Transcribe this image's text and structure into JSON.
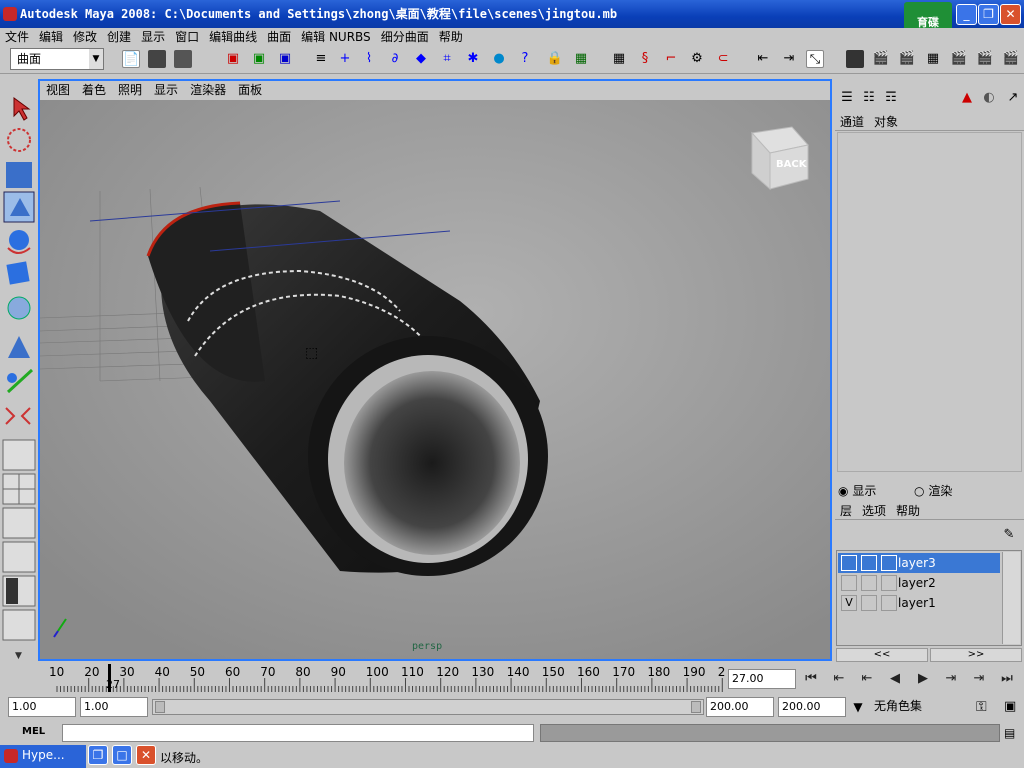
{
  "window": {
    "title": "Autodesk Maya 2008: C:\\Documents and Settings\\zhong\\桌面\\教程\\file\\scenes\\jingtou.mb",
    "logo_text": "育碟\n软件"
  },
  "menu": [
    "文件",
    "编辑",
    "修改",
    "创建",
    "显示",
    "窗口",
    "编辑曲线",
    "曲面",
    "编辑 NURBS",
    "细分曲面",
    "帮助"
  ],
  "shelf": {
    "menu_set": "曲面"
  },
  "viewport": {
    "menu": [
      "视图",
      "着色",
      "照明",
      "显示",
      "渲染器",
      "面板"
    ],
    "camera_label": "persp",
    "viewcube_face": "BACK"
  },
  "channel_box": {
    "tabs": [
      "通道",
      "对象"
    ]
  },
  "layer_editor": {
    "modes": [
      "显示",
      "渲染"
    ],
    "selected_mode": "显示",
    "menu": [
      "层",
      "选项",
      "帮助"
    ],
    "layers": [
      {
        "name": "layer3",
        "visible": "",
        "selected": true
      },
      {
        "name": "layer2",
        "visible": "",
        "selected": false
      },
      {
        "name": "layer1",
        "visible": "V",
        "selected": false
      }
    ],
    "scroll_left": "<<",
    "scroll_right": ">>"
  },
  "timeline": {
    "ticks": [
      "10",
      "20",
      "30",
      "40",
      "50",
      "60",
      "70",
      "80",
      "90",
      "100",
      "110",
      "120",
      "130",
      "140",
      "150",
      "160",
      "170",
      "180",
      "190",
      "2"
    ],
    "current_frame_marker": "27",
    "current_frame": "27.00"
  },
  "range": {
    "start": "1.00",
    "playback_start": "1.00",
    "playback_end": "200.00",
    "end": "200.00",
    "character_set": "无角色集"
  },
  "command": {
    "label": "MEL"
  },
  "status": {
    "help_text": "以移动。"
  },
  "taskbar": {
    "item": "Hype..."
  }
}
